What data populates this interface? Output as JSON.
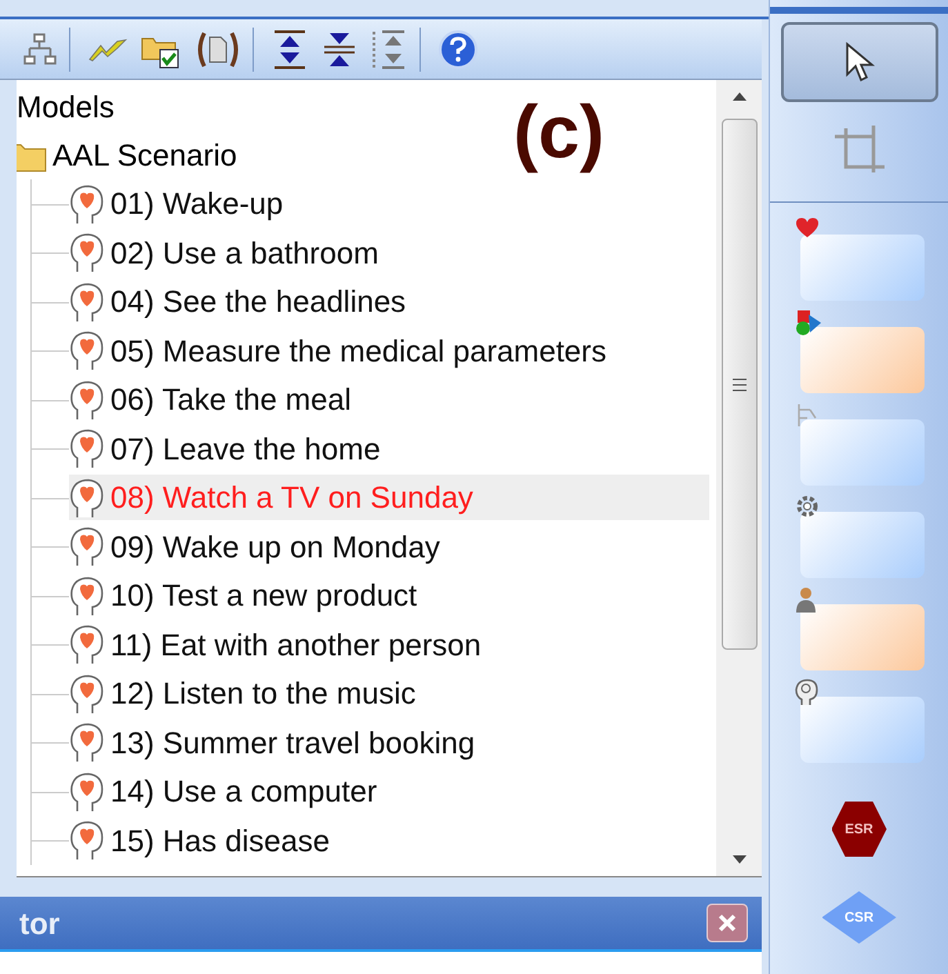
{
  "toolbar": {
    "buttons": [
      {
        "kind": "hierarchy"
      },
      {
        "kind": "bolt"
      },
      {
        "kind": "folder-check"
      },
      {
        "kind": "document"
      },
      {
        "kind": "expand"
      },
      {
        "kind": "collapse"
      },
      {
        "kind": "dotted-expand"
      },
      {
        "kind": "help"
      }
    ]
  },
  "figure_label": "(c)",
  "tree": {
    "root": "Models",
    "children": [
      {
        "label": "AAL Scenario",
        "children": [
          {
            "label": "01) Wake-up",
            "selected": false
          },
          {
            "label": "02) Use a bathroom",
            "selected": false
          },
          {
            "label": "04) See the headlines",
            "selected": false
          },
          {
            "label": "05) Measure the medical parameters",
            "selected": false
          },
          {
            "label": "06) Take the meal",
            "selected": false
          },
          {
            "label": "07) Leave the home",
            "selected": false
          },
          {
            "label": "08) Watch a TV on Sunday",
            "selected": true
          },
          {
            "label": "09) Wake up on Monday",
            "selected": false
          },
          {
            "label": "10) Test a new product",
            "selected": false
          },
          {
            "label": "11) Eat with another person",
            "selected": false
          },
          {
            "label": "12) Listen to the music",
            "selected": false
          },
          {
            "label": "13) Summer travel booking",
            "selected": false
          },
          {
            "label": "14) Use a computer",
            "selected": false
          },
          {
            "label": "15) Has disease",
            "selected": false
          }
        ]
      }
    ]
  },
  "bottom_panel": {
    "title": "tor"
  },
  "palette": {
    "tools": [
      {
        "kind": "pointer",
        "selected": true
      },
      {
        "kind": "crop",
        "selected": false
      }
    ],
    "shapes": [
      {
        "kind": "heart",
        "color": "#a9cdfc"
      },
      {
        "kind": "blocks",
        "color": "#fcc89c"
      },
      {
        "kind": "tree",
        "color": "#a9cdfc"
      },
      {
        "kind": "gear",
        "color": "#a9cdfc"
      },
      {
        "kind": "person",
        "color": "#fcc89c"
      },
      {
        "kind": "head",
        "color": "#a9cdfc"
      }
    ],
    "symbols": [
      {
        "kind": "hexagon",
        "label": "ESR"
      },
      {
        "kind": "diamond",
        "label": "CSR"
      }
    ]
  }
}
